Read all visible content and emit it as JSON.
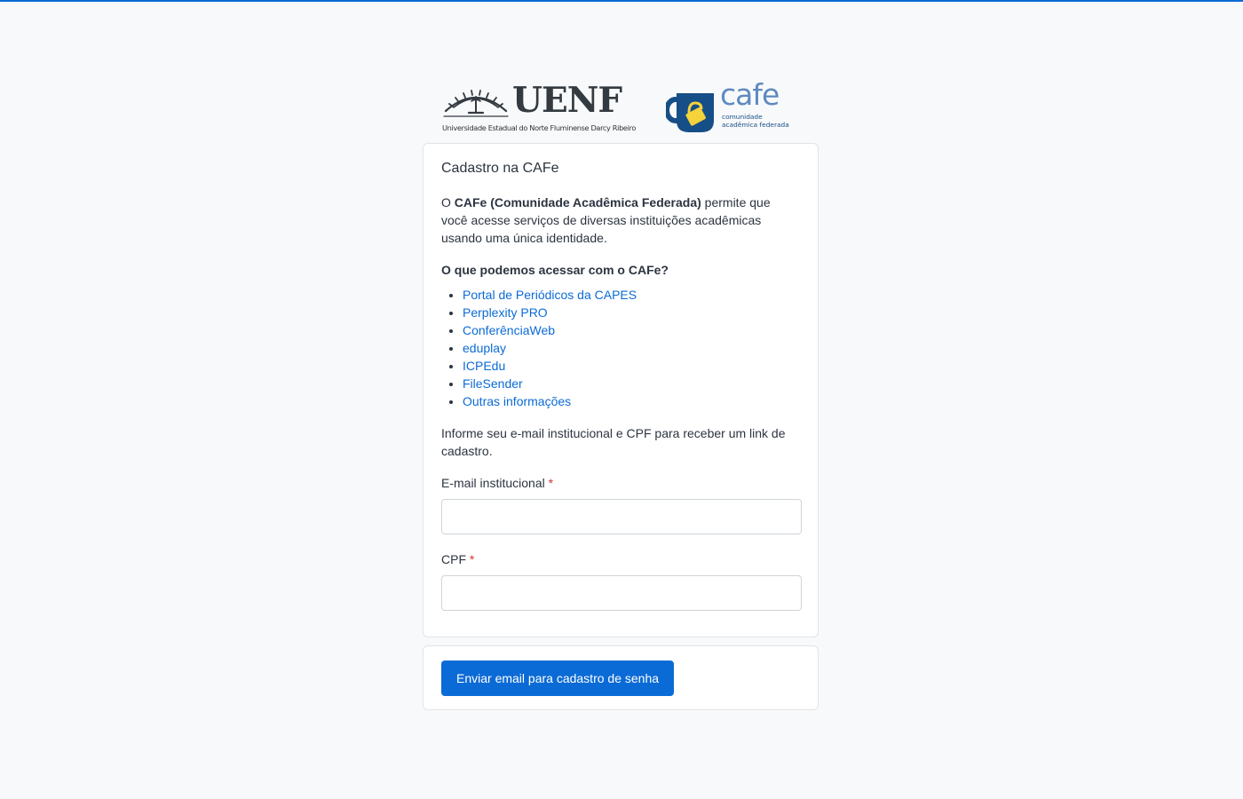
{
  "brand": {
    "uenf_name": "UENF",
    "uenf_fullname": "Universidade Estadual do Norte Fluminense Darcy Ribeiro",
    "cafe_name": "cafe",
    "cafe_tagline_line1": "comunidade",
    "cafe_tagline_line2": "acadêmica federada"
  },
  "card": {
    "title": "Cadastro na CAFe",
    "intro_prefix": "O ",
    "intro_bold": "CAFe (Comunidade Acadêmica Federada)",
    "intro_suffix": " permite que você acesse serviços de diversas instituições acadêmicas usando uma única identidade.",
    "question": "O que podemos acessar com o CAFe?",
    "services": [
      {
        "label": "Portal de Periódicos da CAPES"
      },
      {
        "label": "Perplexity PRO"
      },
      {
        "label": "ConferênciaWeb"
      },
      {
        "label": "eduplay"
      },
      {
        "label": "ICPEdu"
      },
      {
        "label": "FileSender"
      },
      {
        "label": "Outras informações"
      }
    ],
    "instructions": "Informe seu e-mail institucional e CPF para receber um link de cadastro."
  },
  "form": {
    "email_label": "E-mail institucional",
    "email_value": "",
    "email_placeholder": "",
    "cpf_label": "CPF",
    "cpf_value": "",
    "cpf_placeholder": "",
    "required_mark": "*",
    "submit_label": "Enviar email para cadastro de senha"
  },
  "colors": {
    "accent": "#0b6bd6",
    "background": "#f8f9fa",
    "required": "#d63333",
    "cafe_blue": "#5e8ac0",
    "cafe_dark": "#164e87",
    "cafe_yellow": "#f6d23b"
  }
}
